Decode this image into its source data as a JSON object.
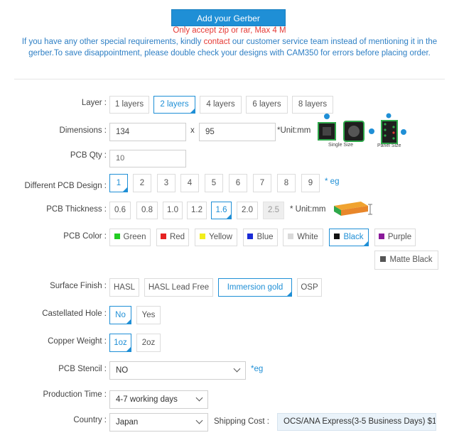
{
  "header": {
    "add_gerber_label": "Add your Gerber",
    "file_note": "Only accept zip or rar, Max 4 M",
    "info_part1": "If you have any other special requirements, kindly ",
    "info_contact": "contact",
    "info_part2": " our customer service team instead of mentioning it in the gerber.To save disappointment, please double check your designs with CAM350 for errors before placing order."
  },
  "layer": {
    "label": "Layer :",
    "options": [
      "1 layers",
      "2 layers",
      "4 layers",
      "6 layers",
      "8 layers"
    ],
    "selected": "2 layers"
  },
  "dimensions": {
    "label": "Dimensions :",
    "width": "134",
    "height": "95",
    "separator": "x",
    "unit": "*Unit:mm",
    "single_size_label": "Single Size",
    "panel_size_label": "Panel Size"
  },
  "qty": {
    "label": "PCB Qty :",
    "value": "10"
  },
  "designs": {
    "label": "Different PCB Design :",
    "options": [
      "1",
      "2",
      "3",
      "4",
      "5",
      "6",
      "7",
      "8",
      "9"
    ],
    "selected": "1",
    "note": "* eg"
  },
  "thickness": {
    "label": "PCB Thickness :",
    "options": [
      "0.6",
      "0.8",
      "1.0",
      "1.2",
      "1.6",
      "2.0",
      "2.5"
    ],
    "selected": "1.6",
    "disabled": "2.5",
    "unit": "* Unit:mm"
  },
  "color": {
    "label": "PCB Color :",
    "options": [
      {
        "label": "Green",
        "swatch": "#22cc22"
      },
      {
        "label": "Red",
        "swatch": "#e52222"
      },
      {
        "label": "Yellow",
        "swatch": "#f2ee1c"
      },
      {
        "label": "Blue",
        "swatch": "#1a2bd6"
      },
      {
        "label": "White",
        "swatch": "#d9d9d9"
      },
      {
        "label": "Black",
        "swatch": "#111111"
      },
      {
        "label": "Purple",
        "swatch": "#8a1a9a"
      },
      {
        "label": "Matte Black",
        "swatch": "#555555"
      }
    ],
    "selected": "Black"
  },
  "finish": {
    "label": "Surface Finish :",
    "options": [
      "HASL",
      "HASL Lead Free",
      "Immersion gold",
      "OSP"
    ],
    "selected": "Immersion gold"
  },
  "castellated": {
    "label": "Castellated Hole :",
    "options": [
      "No",
      "Yes"
    ],
    "selected": "No"
  },
  "copper": {
    "label": "Copper Weight :",
    "options": [
      "1oz",
      "2oz"
    ],
    "selected": "1oz"
  },
  "stencil": {
    "label": "PCB Stencil :",
    "value": "NO",
    "note": "*eg"
  },
  "production": {
    "label": "Production Time :",
    "value": "4-7 working days"
  },
  "country": {
    "label": "Country :",
    "value": "Japan"
  },
  "shipping": {
    "label": "Shipping Cost :",
    "value": "OCS/ANA Express(3-5 Business Days) $1"
  },
  "colors": {
    "accent": "#1f8fd6",
    "alert": "#e53935"
  }
}
